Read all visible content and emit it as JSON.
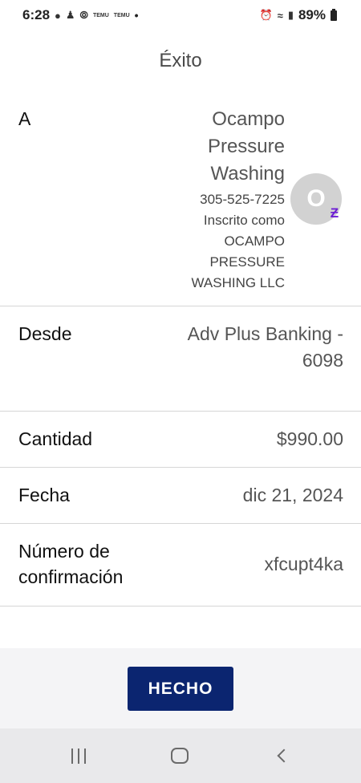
{
  "status_bar": {
    "time": "6:28",
    "temu_1": "TEMU",
    "temu_2": "TEMU",
    "battery": "89%"
  },
  "header": {
    "title": "Éxito"
  },
  "recipient": {
    "label": "A",
    "name_line1": "Ocampo",
    "name_line2": "Pressure",
    "name_line3": "Washing",
    "phone": "305-525-7225",
    "enrolled_line1": "Inscrito como",
    "enrolled_line2": "OCAMPO",
    "enrolled_line3": "PRESSURE",
    "enrolled_line4": "WASHING LLC",
    "avatar_initial": "O",
    "badge": "Ƶ"
  },
  "from": {
    "label": "Desde",
    "value_line1": "Adv Plus Banking -",
    "value_line2": "6098"
  },
  "amount": {
    "label": "Cantidad",
    "value": "$990.00"
  },
  "date": {
    "label": "Fecha",
    "value": "dic 21, 2024"
  },
  "confirmation": {
    "label_line1": "Número de",
    "label_line2": "confirmación",
    "value": "xfcupt4ka"
  },
  "actions": {
    "done_label": "HECHO"
  },
  "colors": {
    "button_bg": "#0b2570",
    "zelle_purple": "#6d1ed4",
    "divider": "#d6d6d6"
  },
  "icons": [
    "message-icon",
    "person-add-icon",
    "messenger-icon",
    "alarm-icon",
    "wifi-icon",
    "signal-icon",
    "battery-icon",
    "recents-icon",
    "home-icon",
    "back-icon"
  ]
}
